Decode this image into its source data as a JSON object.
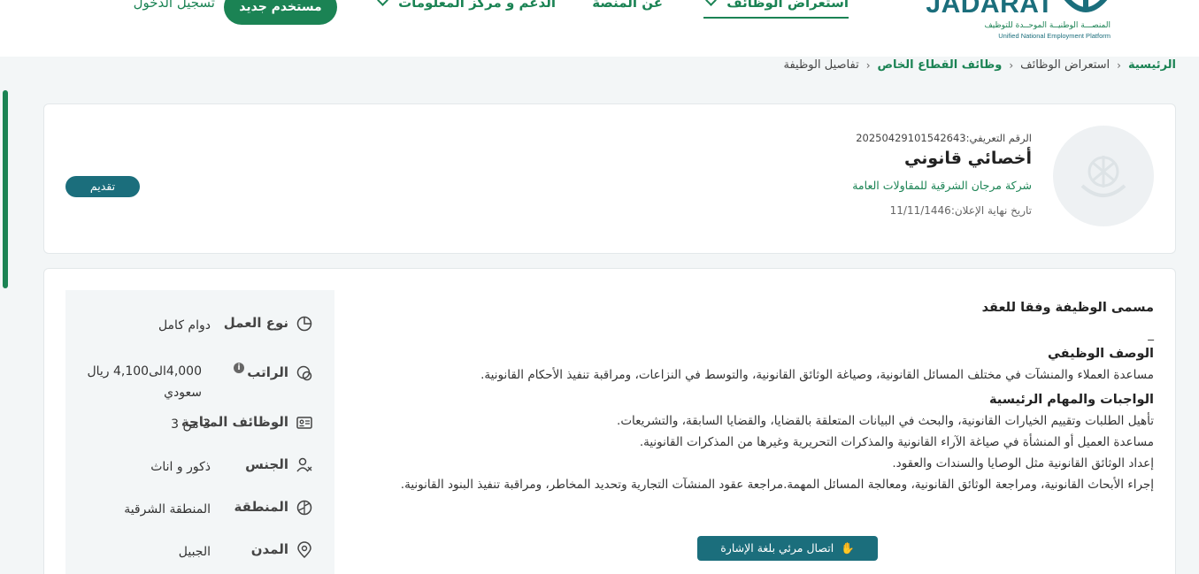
{
  "header": {
    "logo": {
      "word": "JADARAT",
      "arabic_tagline": "المنصـــة الوطنيــة الموحــدة للتوظيف",
      "english_tagline": "Unified National Employment Platform"
    },
    "nav": {
      "jobs": "استعراض الوظائف",
      "about": "عن المنصة",
      "support": "الدعم و مركز المعلومات",
      "register": "مستخدم جديد",
      "login": "تسجيل الدخول"
    }
  },
  "breadcrumb": {
    "home": "الرئيسية",
    "jobs": "استعراض الوظائف",
    "private": "وظائف القطاع الخاص",
    "current": "تفاصيل الوظيفة"
  },
  "job": {
    "ref_label": "الرقم التعريفي:",
    "ref_number": "20250429101542643",
    "title": "أخصائي قانوني",
    "company": "شركة مرجان الشرقية للمقاولات العامة",
    "deadline_label": "تاريخ نهاية الإعلان:",
    "deadline": "11/11/1446",
    "apply_label": "تقديم"
  },
  "details": {
    "work_type": {
      "label": "نوع العمل",
      "value": "دوام كامل"
    },
    "salary": {
      "label": "الراتب",
      "value": "4,000الى4,100 ريال سعودي",
      "info": "i"
    },
    "vacancies": {
      "label": "الوظائف المتاحة",
      "value": "3 من 3"
    },
    "gender": {
      "label": "الجنس",
      "value": "ذكور و اناث"
    },
    "region": {
      "label": "المنطقة",
      "value": "المنطقة الشرقية"
    },
    "city": {
      "label": "المدن",
      "value": "الجبيل"
    }
  },
  "content": {
    "contract_title_heading": "مسمى الوظيفة وفقا للعقد",
    "contract_title_value": "_",
    "description_heading": "الوصف الوظيفي",
    "description": "مساعدة العملاء والمنشآت في مختلف المسائل القانونية، وصياغة الوثائق القانونية، والتوسط في النزاعات، ومراقبة تنفيذ الأحكام القانونية.",
    "duties_heading": "الواجبات والمهام الرئيسية",
    "duties": [
      "تأهيل الطلبات وتقييم الخيارات القانونية، والبحث في البيانات المتعلقة بالقضايا، والقضايا السابقة، والتشريعات.",
      "مساعدة العميل أو المنشأة في صياغة الآراء القانونية والمذكرات التحريرية وغيرها من المذكرات القانونية.",
      "إعداد الوثائق القانونية مثل الوصايا والسندات والعقود.",
      "إجراء الأبحاث القانونية، ومراجعة الوثائق القانونية، ومعالجة المسائل المهمة.مراجعة عقود المنشآت التجارية وتحديد المخاطر، ومراقبة تنفيذ البنود القانونية."
    ],
    "sign_language_button": "اتصال مرئي بلغة الإشارة"
  }
}
